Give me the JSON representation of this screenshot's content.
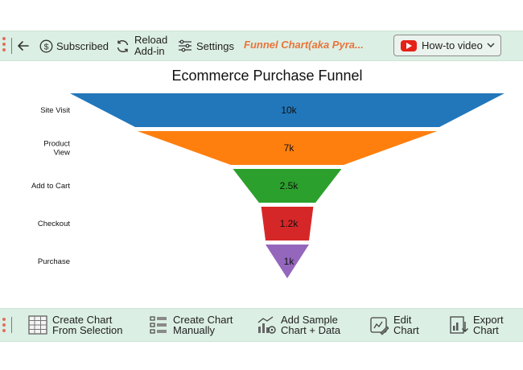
{
  "toolbar": {
    "back_icon": "arrow-left-icon",
    "subscribed": {
      "label": "Subscribed",
      "icon": "dollar-circle-icon"
    },
    "reload": {
      "line1": "Reload",
      "line2": "Add-in",
      "icon": "refresh-icon"
    },
    "settings": {
      "label": "Settings",
      "icon": "sliders-icon"
    },
    "title_tab": "Funnel Chart(aka Pyra...",
    "howto": {
      "label": "How-to video",
      "icon": "youtube-icon"
    }
  },
  "chart_data": {
    "type": "funnel",
    "title": "Ecommerce Purchase Funnel",
    "categories": [
      "Site Visit",
      "Product View",
      "Add to Cart",
      "Checkout",
      "Purchase"
    ],
    "category_lines": [
      [
        "Site Visit"
      ],
      [
        "Product",
        "View"
      ],
      [
        "Add to Cart"
      ],
      [
        "Checkout"
      ],
      [
        "Purchase"
      ]
    ],
    "values": [
      10000,
      7000,
      2500,
      1200,
      1000
    ],
    "value_labels": [
      "10k",
      "7k",
      "2.5k",
      "1.2k",
      "1k"
    ],
    "colors": [
      "#2277bb",
      "#ff7f0e",
      "#2ca02c",
      "#d62728",
      "#9467bd"
    ],
    "legend": "none",
    "grid": false
  },
  "bottom_toolbar": {
    "items": [
      {
        "line1": "Create Chart",
        "line2": "From Selection",
        "icon": "table-grid-icon"
      },
      {
        "line1": "Create Chart",
        "line2": "Manually",
        "icon": "list-form-icon"
      },
      {
        "line1": "Add Sample",
        "line2": "Chart + Data",
        "icon": "chart-gear-icon"
      },
      {
        "line1": "Edit",
        "line2": "Chart",
        "icon": "edit-chart-icon"
      },
      {
        "line1": "Export",
        "line2": "Chart",
        "icon": "export-chart-icon"
      }
    ]
  }
}
